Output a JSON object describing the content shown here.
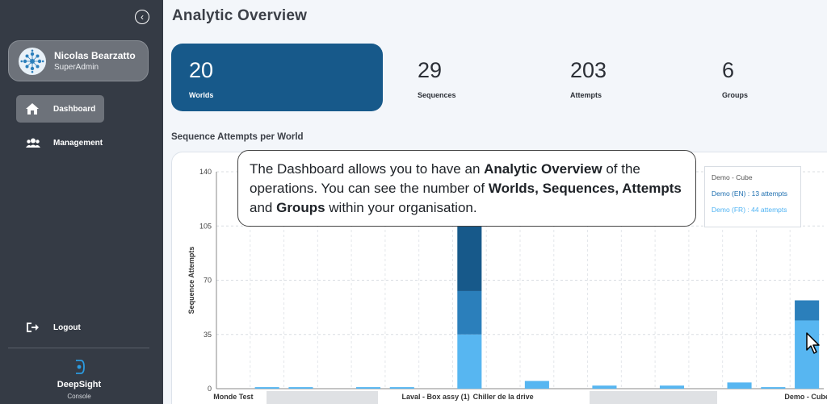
{
  "sidebar": {
    "collapse_icon": "chevron-left-circle-icon",
    "profile": {
      "name": "Nicolas Bearzatto",
      "role": "SuperAdmin"
    },
    "nav": [
      {
        "label": "Dashboard",
        "icon": "home-icon",
        "active": true
      },
      {
        "label": "Management",
        "icon": "users-icon",
        "active": false
      }
    ],
    "logout": {
      "label": "Logout",
      "icon": "logout-icon"
    },
    "brand": {
      "name": "DeepSight",
      "sub": "Console"
    }
  },
  "page": {
    "title": "Analytic Overview"
  },
  "stats": [
    {
      "value": "20",
      "label": "Worlds",
      "active": true
    },
    {
      "value": "29",
      "label": "Sequences",
      "active": false
    },
    {
      "value": "203",
      "label": "Attempts",
      "active": false
    },
    {
      "value": "6",
      "label": "Groups",
      "active": false
    }
  ],
  "section": {
    "title": "Sequence Attempts per World"
  },
  "tooltip": {
    "title": "Demo - Cube",
    "line1": "Demo (EN) : 13 attempts",
    "line2": "Demo (FR) : 44 attempts"
  },
  "callout": {
    "segments": [
      {
        "text": "The Dashboard allows you to have an ",
        "bold": false
      },
      {
        "text": "Analytic Overview",
        "bold": true
      },
      {
        "text": " of the operations. You can see the number of ",
        "bold": false
      },
      {
        "text": "Worlds, Sequences, Attempts",
        "bold": true
      },
      {
        "text": " and ",
        "bold": false
      },
      {
        "text": "Groups",
        "bold": true
      },
      {
        "text": " within your organisation.",
        "bold": false
      }
    ]
  },
  "colors": {
    "series_light": "#57b6f1",
    "series_mid": "#2b7fbb",
    "series_dark": "#17598a",
    "accent": "#17598a"
  },
  "chart_data": {
    "type": "bar",
    "ylabel": "Sequence Attempts",
    "ylim": [
      0,
      140
    ],
    "yticks": [
      0,
      35,
      70,
      105,
      140
    ],
    "grid": true,
    "categories": [
      "Monde Test",
      "",
      "",
      "",
      "",
      "",
      "Laval - Box assy (1)",
      "",
      "Chiller de la drive",
      "",
      "",
      "",
      "",
      "",
      "",
      "",
      "",
      "Demo - Cube"
    ],
    "x_labels_visible": [
      "Monde Test",
      "Laval - Box assy (1)",
      "Chiller de la drive",
      "Demo - Cube"
    ],
    "series": [
      {
        "values": [
          0,
          1,
          1,
          0,
          1,
          1,
          0,
          35,
          0,
          5,
          0,
          2,
          0,
          2,
          0,
          4,
          1,
          44
        ]
      },
      {
        "values": [
          0,
          0,
          0,
          0,
          0,
          0,
          0,
          28,
          0,
          0,
          0,
          0,
          0,
          0,
          0,
          0,
          0,
          13
        ]
      },
      {
        "values": [
          0,
          0,
          0,
          0,
          0,
          0,
          0,
          45,
          0,
          0,
          0,
          0,
          0,
          0,
          0,
          0,
          0,
          0
        ]
      }
    ]
  }
}
